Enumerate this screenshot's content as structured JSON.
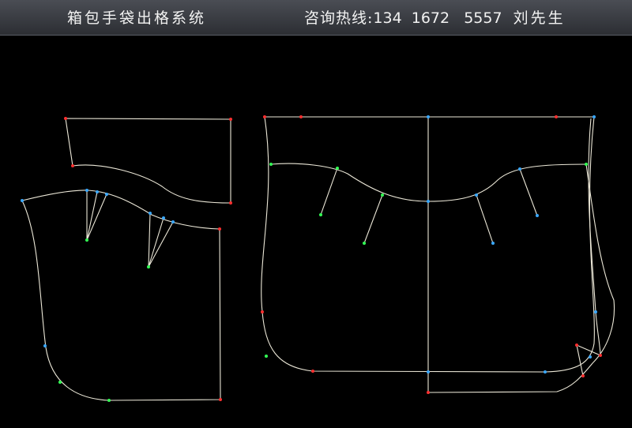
{
  "header": {
    "title": "箱包手袋出格系统",
    "hotline_label": "咨询热线:",
    "hotline_number": "134  1672   5557",
    "contact_name": "刘先生"
  },
  "colors": {
    "background": "#000000",
    "pattern_line": "#ece8d8",
    "point_red": "#ff3030",
    "point_green": "#33ff55",
    "point_blue": "#3aa8ff"
  }
}
